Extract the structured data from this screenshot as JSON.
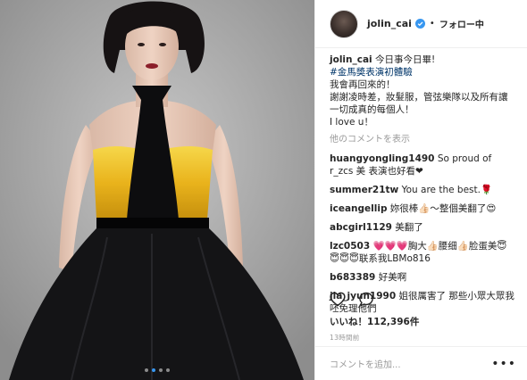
{
  "photo": {
    "carousel": {
      "count": 4,
      "active": 1
    }
  },
  "header": {
    "username": "jolin_cai",
    "separator": "•",
    "follow_label": "フォロー中",
    "verified_color": "#3897f0"
  },
  "caption": {
    "username": "jolin_cai",
    "line1": " 今日事今日畢!",
    "hashtag": "#金馬奬表演初體驗",
    "line3": "我會再回來的！",
    "line4": "謝謝凌時差，妝髮服，管弦樂隊以及所有讓一切成真的每個人！",
    "line5": "I love u！"
  },
  "show_more": "他のコメントを表示",
  "comments": [
    {
      "user": "huangyongling1490",
      "text": " So proud of"
    },
    {
      "user": "",
      "text": "r_zcs 美 表演也好看❤"
    },
    {
      "user": "summer21tw",
      "text": " You are the best.🌹"
    },
    {
      "user": "iceangellip",
      "text": " 妳很棒👍🏻〜整個美翻了😍"
    },
    {
      "user": "abcgirl1129",
      "text": " 美翻了"
    },
    {
      "user": "lzc0503",
      "text": " 💗💗💗胸大👍🏻腰细👍🏻脸蛋美😇😇😇😇联系我LBMo816"
    },
    {
      "user": "b683389",
      "text": " 好美啊"
    },
    {
      "user": "jia_jyun1990",
      "text": " 姐很厲害了 那些小眾大眾我呸免理他們"
    }
  ],
  "actions": {
    "like_icon": "heart-icon",
    "comment_icon": "comment-icon"
  },
  "likes": "いいね！112,396件",
  "timestamp": "13時間前",
  "add_comment": {
    "placeholder": "コメントを追加...",
    "more_icon": "more-dots-icon"
  }
}
